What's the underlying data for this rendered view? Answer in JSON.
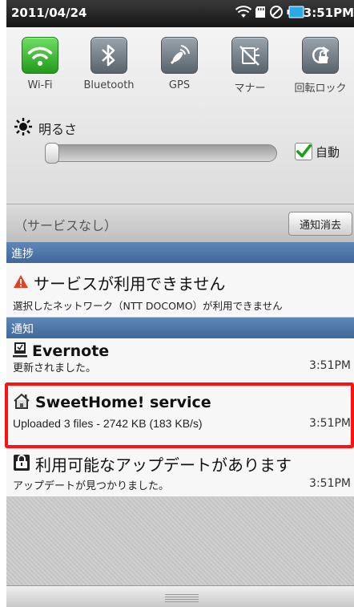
{
  "status_bar": {
    "date": "2011/04/24",
    "time": "3:51PM",
    "icons": [
      "wifi-icon",
      "sd-card-icon",
      "no-signal-icon",
      "battery-icon"
    ]
  },
  "quick_settings": {
    "toggles": [
      {
        "label": "Wi-Fi",
        "icon": "wifi-icon",
        "state": "on"
      },
      {
        "label": "Bluetooth",
        "icon": "bluetooth-icon",
        "state": "off"
      },
      {
        "label": "GPS",
        "icon": "gps-icon",
        "state": "off"
      },
      {
        "label": "マナー",
        "icon": "silent-mode-icon",
        "state": "off"
      },
      {
        "label": "回転ロック",
        "icon": "rotation-lock-icon",
        "state": "off"
      }
    ],
    "brightness_label": "明るさ",
    "brightness_level": 0.0,
    "auto_label": "自動",
    "auto_checked": true
  },
  "carrier_row": {
    "carrier_text": "（サービスなし）",
    "clear_button": "通知消去"
  },
  "ongoing": {
    "header": "進捗",
    "items": [
      {
        "icon": "warning-icon",
        "title": "サービスが利用できません",
        "detail": "選択したネットワーク（NTT DOCOMO）が利用できません",
        "time": ""
      }
    ]
  },
  "notifications": {
    "header": "通知",
    "items": [
      {
        "icon": "evernote-icon",
        "title": "Evernote",
        "detail": "更新されました。",
        "time": "3:51PM"
      },
      {
        "icon": "house-icon",
        "title": "SweetHome! service",
        "detail": "Uploaded 3 files - 2742 KB (183 KB/s)",
        "time": "3:51PM"
      },
      {
        "icon": "update-icon",
        "title": "利用可能なアップデートがあります",
        "detail": "アップデートが見つかりました。",
        "time": "3:51PM"
      }
    ]
  },
  "colors": {
    "highlight": "#ff1111",
    "section_header": "#4a72a5",
    "toggle_on": "#2fb42a"
  }
}
